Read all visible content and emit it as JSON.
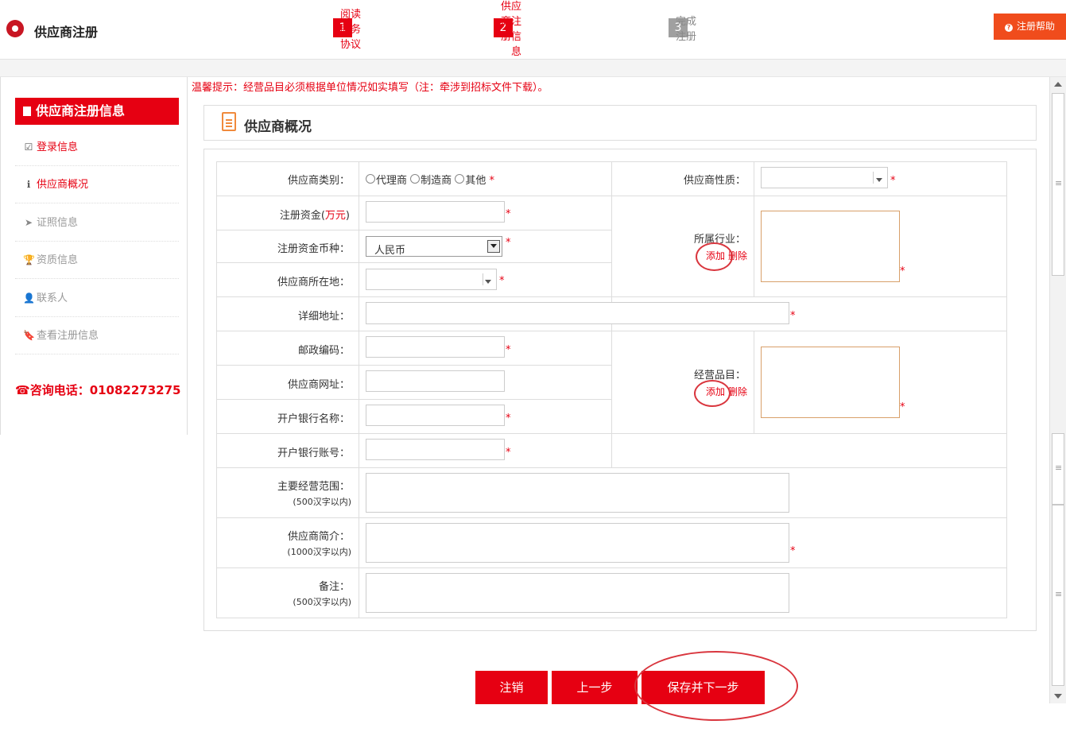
{
  "header": {
    "title": "供应商注册",
    "steps": [
      {
        "num": "1",
        "label": "阅读服务协议",
        "state": "done"
      },
      {
        "num": "2",
        "label": "供应商注册信息",
        "state": "current"
      },
      {
        "num": "3",
        "label": "完成注册",
        "state": "pending"
      }
    ],
    "help_label": "注册帮助",
    "help_icon": "?"
  },
  "sidebar": {
    "title": "供应商注册信息",
    "items": [
      {
        "label": "登录信息",
        "icon": "☑"
      },
      {
        "label": "供应商概况",
        "icon": "ℹ"
      },
      {
        "label": "证照信息",
        "icon": "➤"
      },
      {
        "label": "资质信息",
        "icon": "🏆"
      },
      {
        "label": "联系人",
        "icon": "👤"
      },
      {
        "label": "查看注册信息",
        "icon": "🔖"
      }
    ],
    "phone": "咨询电话：01082273275"
  },
  "tip": "温馨提示：经营品目必须根据单位情况如实填写（注：牵涉到招标文件下载）。",
  "section_title": "供应商概况",
  "form": {
    "supplier_type_label": "供应商类别：",
    "supplier_type_options": [
      "代理商",
      "制造商",
      "其他"
    ],
    "supplier_nature_label": "供应商性质：",
    "reg_capital_label": "注册资金(",
    "reg_capital_unit": "万元",
    "reg_capital_close": ")",
    "currency_label": "注册资金币种：",
    "currency_value": "人民币",
    "location_label": "供应商所在地：",
    "industry_label": "所属行业：",
    "add_label": "添加",
    "delete_label": "删除",
    "address_label": "详细地址：",
    "postcode_label": "邮政编码：",
    "website_label": "供应商网址：",
    "bank_name_label": "开户银行名称：",
    "bank_account_label": "开户银行账号：",
    "business_items_label": "经营品目：",
    "scope_label": "主要经营范围：",
    "scope_limit": "(500汉字以内)",
    "intro_label": "供应商简介：",
    "intro_limit": "(1000汉字以内)",
    "remark_label": "备注：",
    "remark_limit": "(500汉字以内)",
    "required_mark": "*"
  },
  "buttons": {
    "cancel": "注销",
    "prev": "上一步",
    "save_next": "保存并下一步"
  },
  "colors": {
    "brand_red": "#e60012",
    "help_orange": "#f04c1c"
  }
}
